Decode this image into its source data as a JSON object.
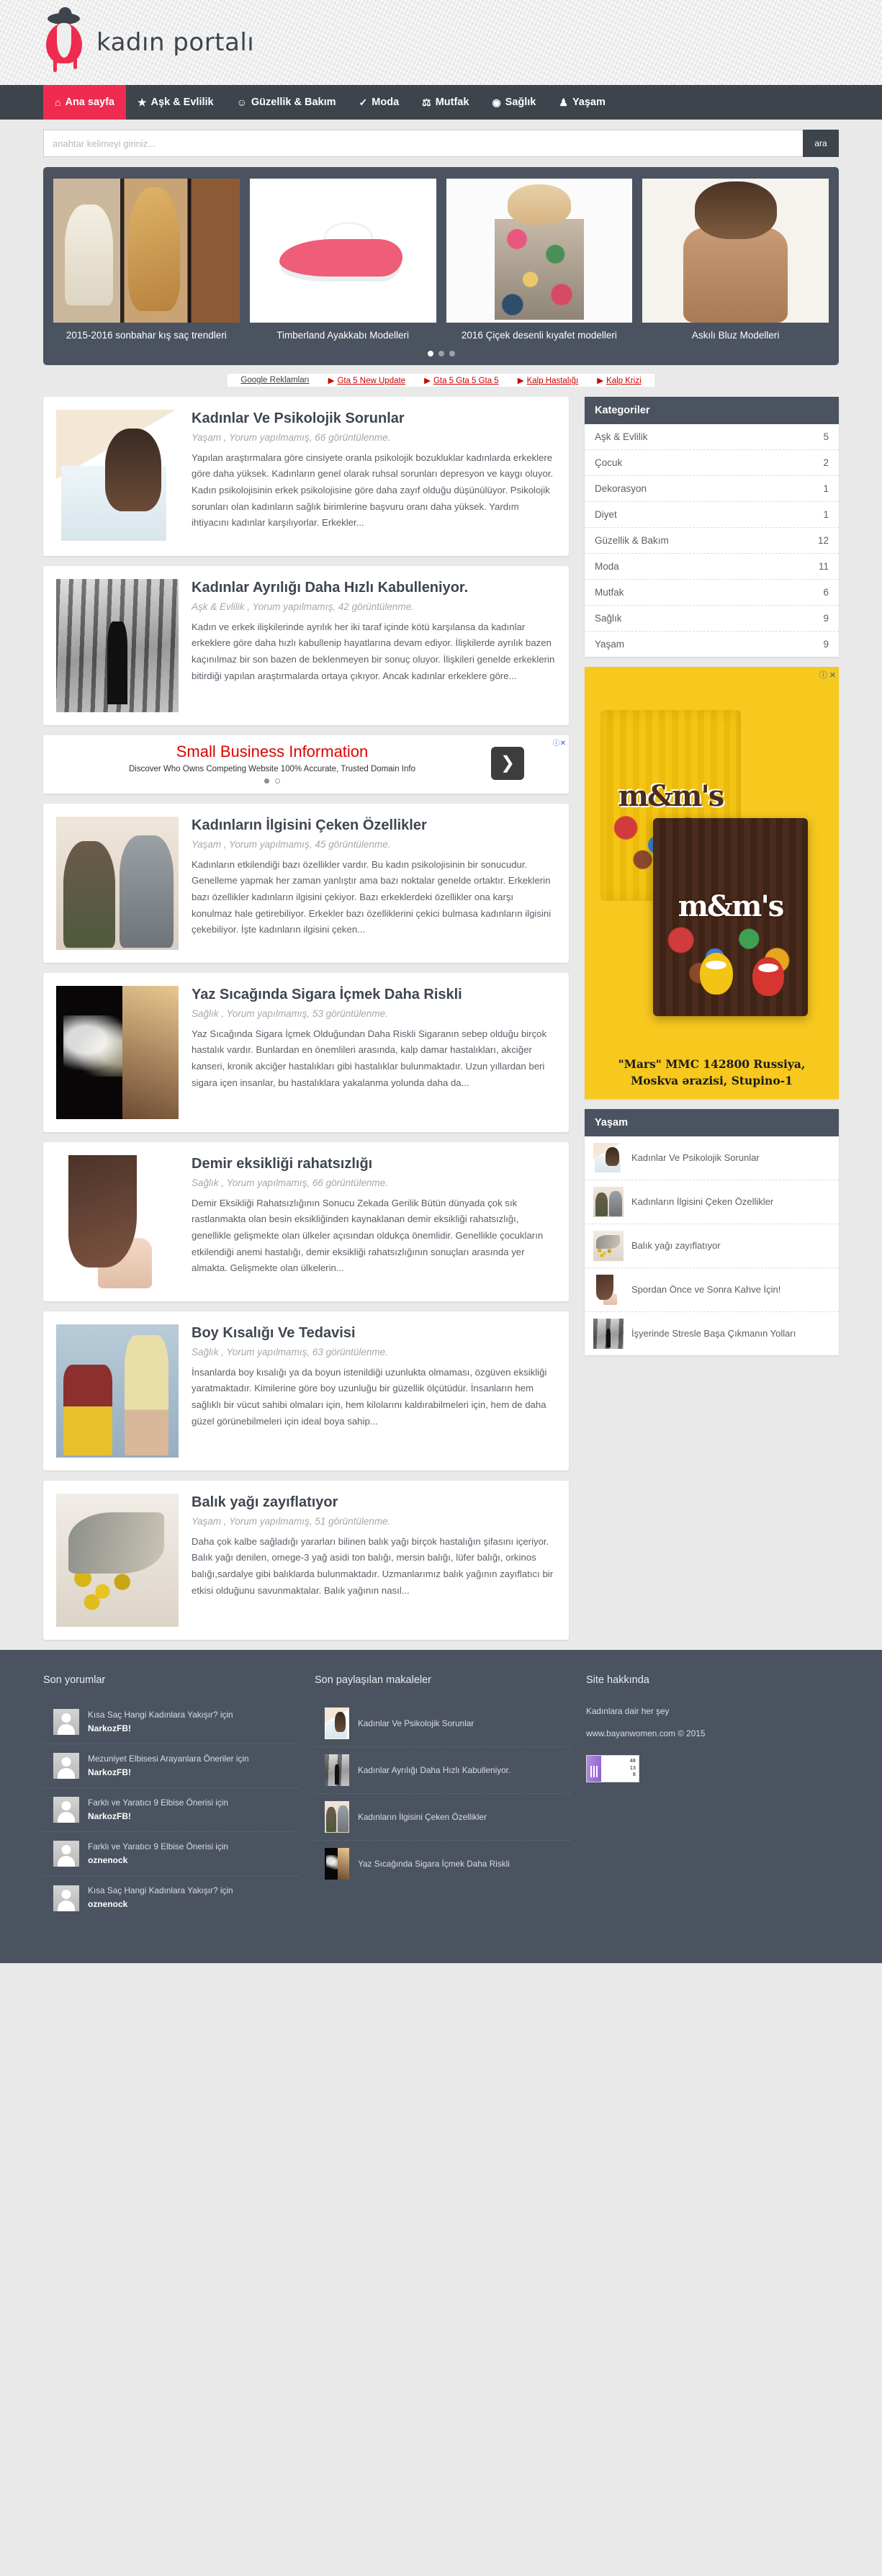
{
  "site": {
    "logo_text": "kadın portalı",
    "accent_color": "#ef2b50",
    "dark_color": "#3d444c"
  },
  "nav": {
    "items": [
      {
        "label": "Ana sayfa",
        "icon": "home-icon",
        "glyph": "⌂",
        "active": true
      },
      {
        "label": "Aşk & Evlilik",
        "icon": "star-icon",
        "glyph": "★",
        "active": false
      },
      {
        "label": "Güzellik & Bakım",
        "icon": "smiley-icon",
        "glyph": "☺",
        "active": false
      },
      {
        "label": "Moda",
        "icon": "check-icon",
        "glyph": "✓",
        "active": false
      },
      {
        "label": "Mutfak",
        "icon": "utensil-icon",
        "glyph": "⚖",
        "active": false
      },
      {
        "label": "Sağlık",
        "icon": "circle-icon",
        "glyph": "◉",
        "active": false
      },
      {
        "label": "Yaşam",
        "icon": "dress-icon",
        "glyph": "♟",
        "active": false
      }
    ]
  },
  "search": {
    "placeholder": "anahtar kelimeyi giriniz...",
    "value": "",
    "button_label": "ara"
  },
  "slider": {
    "slides": [
      {
        "caption": "2015-2016 sonbahar kış saç trendleri",
        "art": "a1"
      },
      {
        "caption": "Timberland Ayakkabı Modelleri",
        "art": "a2"
      },
      {
        "caption": "2016 Çiçek desenli kıyafet modelleri",
        "art": "a3"
      },
      {
        "caption": "Askılı Bluz Modelleri",
        "art": "a4"
      }
    ],
    "dots": [
      true,
      false,
      false
    ]
  },
  "ad_links": {
    "label": "Google Reklamları",
    "links": [
      "Gta 5 New Update",
      "Gta 5 Gta 5 Gta 5",
      "Kalp Hastalığı",
      "Kalp Krizi"
    ]
  },
  "posts": [
    {
      "title": "Kadınlar Ve Psikolojik Sorunlar",
      "meta": "Yaşam , Yorum yapılmamış, 66 görüntülenme.",
      "excerpt": "Yapılan araştırmalara göre cinsiyete oranla psikolojik bozukluklar kadınlarda erkeklere göre daha yüksek. Kadınların genel olarak ruhsal sorunları depresyon ve kaygı oluyor. Kadın psikolojisinin erkek psikolojisine göre daha zayıf olduğu düşünülüyor. Psikolojik sorunları olan kadınların sağlık birimlerine başvuru oranı daha yüksek. Yardım ihtiyacını kadınlar karşılıyorlar. Erkekler...",
      "art": "t1"
    },
    {
      "title": "Kadınlar Ayrılığı Daha Hızlı Kabulleniyor.",
      "meta": "Aşk & Evlilik , Yorum yapılmamış, 42 görüntülenme.",
      "excerpt": "Kadın ve erkek ilişkilerinde ayrılık her iki taraf içinde kötü karşılansa da kadınlar erkeklere göre daha hızlı kabullenip hayatlarına devam ediyor. İlişkilerde ayrılık bazen kaçınılmaz bir son bazen de beklenmeyen bir sonuç oluyor. İlişkileri genelde erkeklerin bitirdiği yapılan araştırmalarda ortaya çıkıyor. Ancak kadınlar erkeklere göre...",
      "art": "t2"
    },
    {
      "title": "Kadınların İlgisini Çeken Özellikler",
      "meta": "Yaşam , Yorum yapılmamış, 45 görüntülenme.",
      "excerpt": "Kadınların etkilendiği bazı özellikler vardır. Bu kadın psikolojisinin bir sonucudur. Genelleme yapmak her zaman yanlıştır ama bazı noktalar genelde ortaktır. Erkeklerin bazı özellikler kadınların ilgisini çekiyor. Bazı erkeklerdeki özellikler ona karşı konulmaz hale getirebiliyor. Erkekler bazı özelliklerini çekici bulmasa kadınların ilgisini çekebiliyor. İşte kadınların ilgisini çeken...",
      "art": "t3"
    },
    {
      "title": "Yaz Sıcağında Sigara İçmek Daha Riskli",
      "meta": "Sağlık , Yorum yapılmamış, 53 görüntülenme.",
      "excerpt": "Yaz Sıcağında Sigara İçmek Olduğundan Daha Riskli Sigaranın sebep olduğu birçok hastalık vardır. Bunlardan en önemlileri arasında, kalp damar hastalıkları, akciğer kanseri, kronik akciğer hastalıkları gibi hastalıklar bulunmaktadır. Uzun yıllardan beri sigara içen insanlar, bu hastalıklara yakalanma yolunda daha da...",
      "art": "t4"
    },
    {
      "title": "Demir eksikliği rahatsızlığı",
      "meta": "Sağlık , Yorum yapılmamış, 66 görüntülenme.",
      "excerpt": "Demir Eksikliği Rahatsızlığının Sonucu Zekada Gerilik Bütün dünyada çok sık rastlanmakta olan besin eksikliğinden kaynaklanan demir eksikliği rahatsızlığı, genellikle gelişmekte olan ülkeler açısından oldukça önemlidir. Genellikle çocukların etkilendiği anemi hastalığı, demir eksikliği rahatsızlığının sonuçları arasında yer almakta. Gelişmekte olan ülkelerin...",
      "art": "t5"
    },
    {
      "title": "Boy Kısalığı Ve Tedavisi",
      "meta": "Sağlık , Yorum yapılmamış, 63 görüntülenme.",
      "excerpt": "İnsanlarda boy kısalığı ya da boyun istenildiği uzunlukta olmaması, özgüven eksikliği yaratmaktadır. Kimilerine göre boy uzunluğu bir güzellik ölçütüdür. İnsanların hem sağlıklı bir vücut sahibi olmaları için, hem kilolarını kaldırabilmeleri için, hem de daha güzel görünebilmeleri için ideal boya sahip...",
      "art": "t6"
    },
    {
      "title": "Balık yağı zayıflatıyor",
      "meta": "Yaşam , Yorum yapılmamış, 51 görüntülenme.",
      "excerpt": "Daha çok kalbe sağladığı yararları bilinen balık yağı birçok hastalığın şifasını içeriyor. Balık yağı denilen, omege-3 yağ asidi ton balığı, mersin balığı, lüfer balığı, orkinos balığı,sardalye gibi balıklarda bulunmaktadır. Uzmanlarımız balık yağının zayıflatıcı bir etkisi olduğunu savunmaktalar. Balık yağının nasıl...",
      "art": "t7"
    }
  ],
  "inline_ad": {
    "headline": "Small Business Information",
    "sub": "Discover Who Owns Competing Website 100% Accurate, Trusted Domain Info",
    "arrow_glyph": "❯",
    "info_glyph": "ⓘ",
    "close_glyph": "✕"
  },
  "sidebar": {
    "categories_widget": {
      "title": "Kategoriler",
      "rows": [
        {
          "label": "Aşk & Evlilik",
          "count": "5"
        },
        {
          "label": "Çocuk",
          "count": "2"
        },
        {
          "label": "Dekorasyon",
          "count": "1"
        },
        {
          "label": "Diyet",
          "count": "1"
        },
        {
          "label": "Güzellik & Bakım",
          "count": "12"
        },
        {
          "label": "Moda",
          "count": "11"
        },
        {
          "label": "Mutfak",
          "count": "6"
        },
        {
          "label": "Sağlık",
          "count": "9"
        },
        {
          "label": "Yaşam",
          "count": "9"
        }
      ]
    },
    "banner_ad": {
      "caption": "\"Mars\" MMC 142800 Russiya, Moskva ərazisi, Stupino-1",
      "brand": "m&m's",
      "info_glyph": "ⓘ",
      "close_glyph": "✕"
    },
    "yasam_widget": {
      "title": "Yaşam",
      "items": [
        {
          "title": "Kadınlar Ve Psikolojik Sorunlar",
          "art": "t1"
        },
        {
          "title": "Kadınların İlgisini Çeken Özellikler",
          "art": "t3"
        },
        {
          "title": "Balık yağı zayıflatıyor",
          "art": "t7"
        },
        {
          "title": "Spordan Önce ve Sonra Kahve İçin!",
          "art": "t5"
        },
        {
          "title": "İşyerinde Stresle Başa Çıkmanın Yolları",
          "art": "t2"
        }
      ]
    }
  },
  "footer": {
    "comments_head": "Son yorumlar",
    "comments": [
      {
        "text": "Kısa Saç Hangi Kadınlara Yakışır? için",
        "user": "NarkozFB!"
      },
      {
        "text": "Mezuniyet Elbisesi Arayanlara Öneriler için",
        "user": "NarkozFB!"
      },
      {
        "text": "Farklı ve Yaratıcı 9 Elbise Önerisi için",
        "user": "NarkozFB!"
      },
      {
        "text": "Farklı ve Yaratıcı 9 Elbise Önerisi için",
        "user": "oznenock"
      },
      {
        "text": "Kısa Saç Hangi Kadınlara Yakışır? için",
        "user": "oznenock"
      }
    ],
    "articles_head": "Son paylaşılan makaleler",
    "articles": [
      {
        "title": "Kadınlar Ve Psikolojik Sorunlar",
        "art": "t1"
      },
      {
        "title": "Kadınlar Ayrılığı Daha Hızlı Kabulleniyor.",
        "art": "t2"
      },
      {
        "title": "Kadınların İlgisini Çeken Özellikler",
        "art": "t3"
      },
      {
        "title": "Yaz Sıcağında Sigara İçmek Daha Riskli",
        "art": "t4"
      }
    ],
    "about_head": "Site hakkında",
    "about_line1": "Kadınlara dair her şey",
    "about_line2": "www.bayanwomen.com © 2015",
    "counter": [
      "48",
      "13",
      "8"
    ]
  }
}
